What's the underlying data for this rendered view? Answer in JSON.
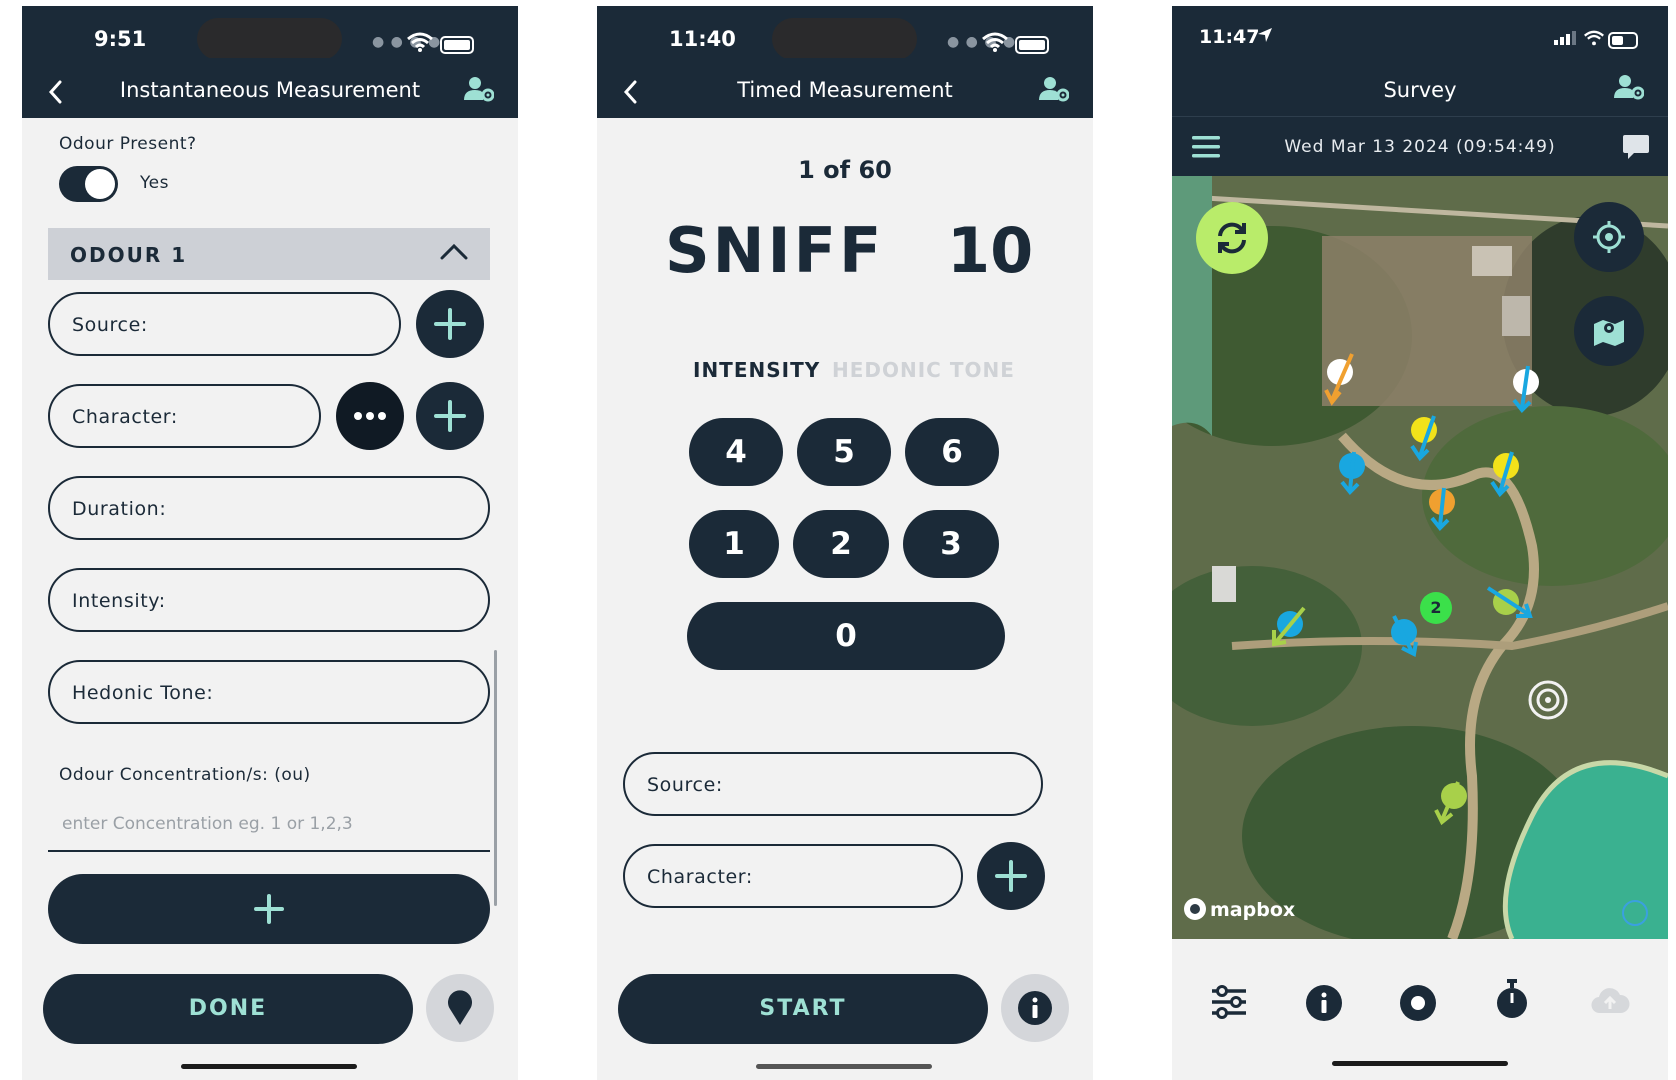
{
  "colors": {
    "navy": "#1b2a38",
    "accent_teal": "#9ee0d4",
    "refresh_green": "#b9ec6a",
    "cluster_green": "#3be04a",
    "marker_orange": "#f0a030",
    "marker_yellow": "#f2e21a",
    "marker_blue": "#19a7e0",
    "marker_lime": "#a8d04a"
  },
  "instant": {
    "status_time": "9:51",
    "title": "Instantaneous Measurement",
    "odour_present_label": "Odour Present?",
    "toggle_value": "Yes",
    "section_title": "ODOUR 1",
    "fields": {
      "source": "Source:",
      "character": "Character:",
      "duration": "Duration:",
      "intensity": "Intensity:",
      "hedonic": "Hedonic Tone:"
    },
    "concentration_label": "Odour Concentration/s: (ou)",
    "concentration_placeholder": "enter Concentration eg. 1 or 1,2,3",
    "add_symbol": "+",
    "done_label": "DONE",
    "icons": [
      "chevron-left-icon",
      "user-settings-icon",
      "chevron-up-icon",
      "plus-icon",
      "more-dots-icon",
      "location-pin-icon"
    ]
  },
  "timed": {
    "status_time": "11:40",
    "title": "Timed Measurement",
    "counter": "1 of 60",
    "sniff_label": "SNIFF",
    "sniff_value": "10",
    "tab_intensity": "INTENSITY",
    "tab_hedonic": "HEDONIC TONE",
    "keys": [
      "4",
      "5",
      "6",
      "1",
      "2",
      "3",
      "0"
    ],
    "source_label": "Source:",
    "character_label": "Character:",
    "start_label": "START",
    "icons": [
      "chevron-left-icon",
      "user-settings-icon",
      "plus-icon",
      "info-icon"
    ]
  },
  "survey": {
    "status_time": "11:47",
    "title": "Survey",
    "datetime": "Wed Mar 13 2024 (09:54:49)",
    "cluster_count": "2",
    "attribution": "mapbox",
    "tab_icons": [
      "filter-sliders-icon",
      "info-icon",
      "record-icon",
      "stopwatch-icon",
      "cloud-upload-icon"
    ],
    "map_icons": [
      "refresh-icon",
      "crosshair-icon",
      "map-pin-icon",
      "target-icon"
    ]
  }
}
